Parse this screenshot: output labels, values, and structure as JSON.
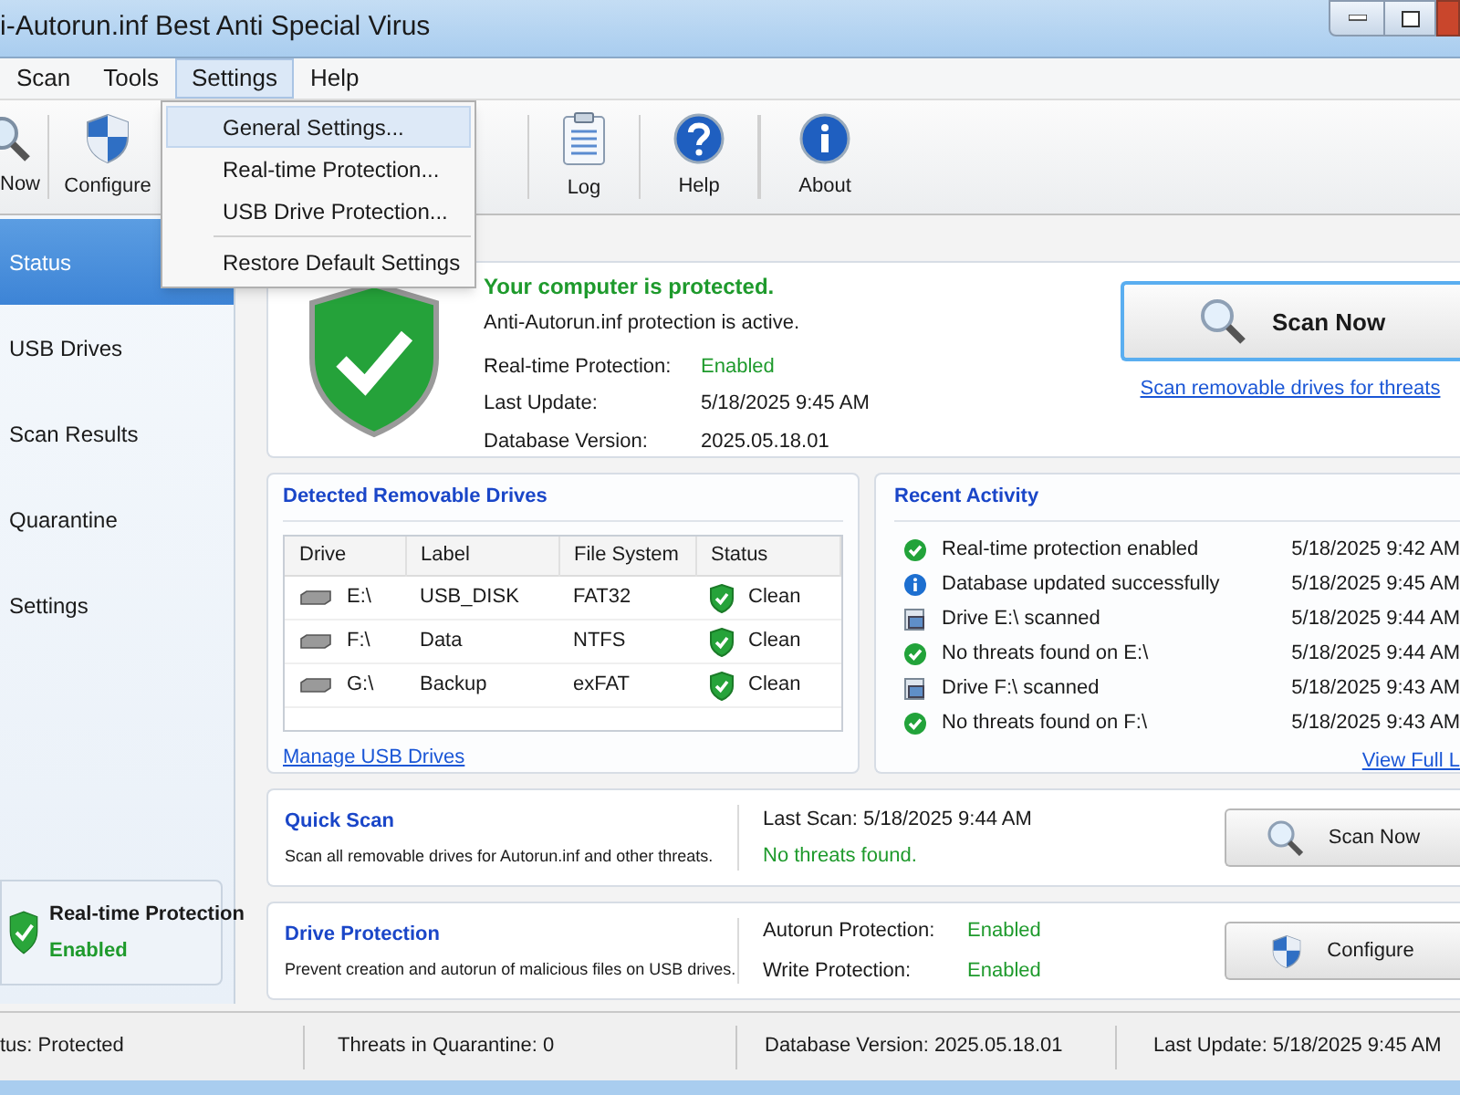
{
  "window": {
    "title": "i-Autorun.inf Best Anti Special Virus"
  },
  "menu": [
    {
      "label": "Scan",
      "selected": false
    },
    {
      "label": "Tools",
      "selected": false
    },
    {
      "label": "Settings",
      "selected": true
    },
    {
      "label": "Help",
      "selected": false
    }
  ],
  "dropdown": [
    {
      "kind": "item",
      "label": "General Settings...",
      "selected": true
    },
    {
      "kind": "item",
      "label": "Real-time Protection...",
      "selected": false
    },
    {
      "kind": "item",
      "label": "USB Drive Protection...",
      "selected": false
    },
    {
      "kind": "separator"
    },
    {
      "kind": "item",
      "label": "Restore Default Settings",
      "selected": false
    }
  ],
  "toolbar": [
    {
      "kind": "scan",
      "label": "Now"
    },
    {
      "kind": "shield",
      "label": "Configure"
    },
    {
      "kind": "gap"
    },
    {
      "kind": "log",
      "label": "Log"
    },
    {
      "kind": "help",
      "label": "Help"
    },
    {
      "kind": "info",
      "label": "About"
    }
  ],
  "sidebar": {
    "items": [
      {
        "label": "Status",
        "selected": true
      },
      {
        "label": "USB Drives",
        "selected": false
      },
      {
        "label": "Scan Results",
        "selected": false
      },
      {
        "label": "Quarantine",
        "selected": false
      },
      {
        "label": "Settings",
        "selected": false
      }
    ],
    "protection": {
      "title": "Real-time Protection",
      "value": "Enabled"
    }
  },
  "status": {
    "headline": "Your computer is protected.",
    "message": "Anti-Autorun.inf protection is active.",
    "fields": [
      {
        "label": "Real-time Protection:",
        "value": "Enabled",
        "ok": true
      },
      {
        "label": "Last Update:",
        "value": "5/18/2025 9:45 AM",
        "ok": false
      },
      {
        "label": "Database Version:",
        "value": "2025.05.18.01",
        "ok": false
      }
    ],
    "button": "Scan Now",
    "link": "Scan removable drives for threats"
  },
  "drives": {
    "title": "Detected Removable Drives",
    "columns": [
      "Drive",
      "Label",
      "File System",
      "Status"
    ],
    "rows": [
      [
        "E:\\",
        "USB_DISK",
        "FAT32",
        "Clean"
      ],
      [
        "F:\\",
        "Data",
        "NTFS",
        "Clean"
      ],
      [
        "G:\\",
        "Backup",
        "exFAT",
        "Clean"
      ]
    ],
    "link": "Manage USB Drives"
  },
  "activity": {
    "title": "Recent Activity",
    "items": [
      {
        "kind": "ok",
        "text": "Real-time protection enabled",
        "time": "5/18/2025 9:42 AM"
      },
      {
        "kind": "info",
        "text": "Database updated successfully",
        "time": "5/18/2025 9:45 AM"
      },
      {
        "kind": "drive",
        "text": "Drive E:\\ scanned",
        "time": "5/18/2025 9:44 AM"
      },
      {
        "kind": "ok",
        "text": "No threats found on E:\\",
        "time": "5/18/2025 9:44 AM"
      },
      {
        "kind": "drive",
        "text": "Drive F:\\ scanned",
        "time": "5/18/2025 9:43 AM"
      },
      {
        "kind": "ok",
        "text": "No threats found on F:\\",
        "time": "5/18/2025 9:43 AM"
      }
    ],
    "link": "View Full L"
  },
  "quick_scan": {
    "title": "Quick Scan",
    "description": "Scan all removable drives for Autorun.inf and other threats.",
    "last_scan": "Last Scan: 5/18/2025 9:44 AM",
    "result": "No threats found.",
    "button": "Scan Now"
  },
  "drive_protection": {
    "title": "Drive Protection",
    "description": "Prevent creation and autorun of malicious files on USB drives.",
    "fields": [
      {
        "label": "Autorun Protection:",
        "value": "Enabled"
      },
      {
        "label": "Write Protection:",
        "value": "Enabled"
      }
    ],
    "button": "Configure"
  },
  "status_bar": [
    "tus: Protected",
    "Threats in Quarantine: 0",
    "Database Version: 2025.05.18.01",
    "Last Update:  5/18/2025 9:45 AM"
  ]
}
